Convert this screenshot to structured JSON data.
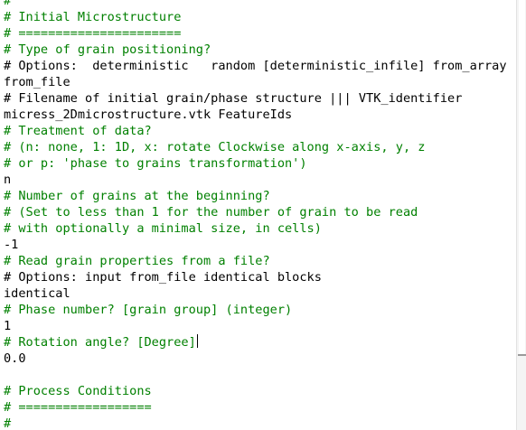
{
  "editor": {
    "lines": [
      {
        "text": "#",
        "kind": "comment"
      },
      {
        "text": "# Initial Microstructure",
        "kind": "comment"
      },
      {
        "text": "# ======================",
        "kind": "comment"
      },
      {
        "text": "# Type of grain positioning?",
        "kind": "comment"
      },
      {
        "text": "# Options:  deterministic   random [deterministic_infile] from_array",
        "kind": "code"
      },
      {
        "text": "from_file",
        "kind": "code"
      },
      {
        "text": "# Filename of initial grain/phase structure ||| VTK_identifier",
        "kind": "code"
      },
      {
        "text": "micress_2Dmicrostructure.vtk FeatureIds",
        "kind": "code"
      },
      {
        "text": "# Treatment of data?",
        "kind": "comment"
      },
      {
        "text": "# (n: none, 1: 1D, x: rotate Clockwise along x-axis, y, z",
        "kind": "comment"
      },
      {
        "text": "# or p: 'phase to grains transformation')",
        "kind": "comment"
      },
      {
        "text": "n",
        "kind": "code"
      },
      {
        "text": "# Number of grains at the beginning?",
        "kind": "comment"
      },
      {
        "text": "# (Set to less than 1 for the number of grain to be read",
        "kind": "comment"
      },
      {
        "text": "# with optionally a minimal size, in cells)",
        "kind": "comment"
      },
      {
        "text": "-1",
        "kind": "code"
      },
      {
        "text": "# Read grain properties from a file?",
        "kind": "comment"
      },
      {
        "text": "# Options: input from_file identical blocks",
        "kind": "code"
      },
      {
        "text": "identical",
        "kind": "code"
      },
      {
        "text": "# Phase number? [grain group] (integer)",
        "kind": "comment"
      },
      {
        "text": "1",
        "kind": "code"
      },
      {
        "text": "# Rotation angle? [Degree]",
        "kind": "comment",
        "caret": true
      },
      {
        "text": "0.0",
        "kind": "code"
      },
      {
        "text": "",
        "kind": "code"
      },
      {
        "text": "# Process Conditions",
        "kind": "comment"
      },
      {
        "text": "# ==================",
        "kind": "comment"
      },
      {
        "text": "#",
        "kind": "comment"
      }
    ]
  },
  "colors": {
    "comment": "#008000",
    "code": "#000000",
    "background": "#ffffff"
  }
}
